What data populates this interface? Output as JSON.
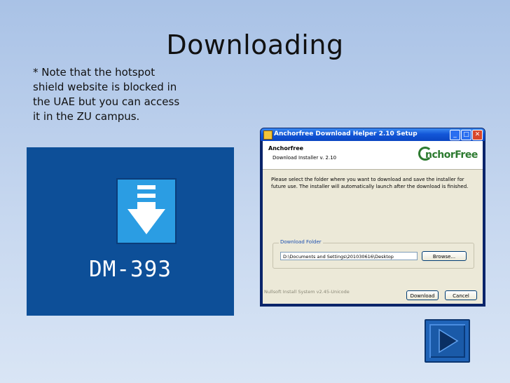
{
  "slide": {
    "title": "Downloading",
    "note": "* Note that the hotspot shield website is blocked in the UAE but you can access it in the ZU campus."
  },
  "dm_tile": {
    "label": "DM-393",
    "icon": "download-arrow-icon",
    "bg_color": "#0d4f98",
    "icon_color": "#2b9de3"
  },
  "installer": {
    "window_title": "Anchorfree Download Helper 2.10 Setup",
    "header_title": "Anchorfree",
    "header_subtitle": "Download Installer v. 2.10",
    "logo_text": "nchorFree",
    "instructions": "Please select the folder where you want to download and save the installer for future use. The installer will automatically launch after the download is finished.",
    "group_label": "Download Folder",
    "folder_path": "D:\\Documents and Settings\\201030616\\Desktop",
    "browse_label": "Browse...",
    "branding": "Nullsoft Install System v2.45-Unicode",
    "download_label": "Download",
    "cancel_label": "Cancel",
    "titlebar_buttons": {
      "minimize": "_",
      "maximize": "□",
      "close": "✕"
    }
  },
  "nav": {
    "next_icon": "play-next-icon"
  }
}
